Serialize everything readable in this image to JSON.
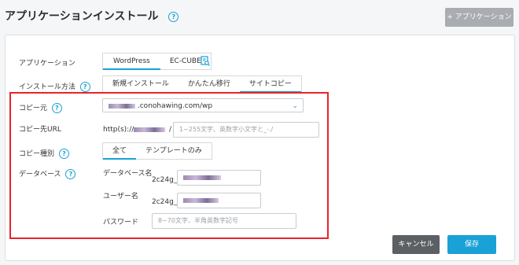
{
  "page": {
    "title": "アプリケーションインストール",
    "help_glyph": "?",
    "top_button_label": "+ アプリケーション"
  },
  "form": {
    "app_label": "アプリケーション",
    "app_tabs": [
      "WordPress",
      "EC-CUBE"
    ],
    "method_label": "インストール方法",
    "method_tabs": [
      "新規インストール",
      "かんたん移行",
      "サイトコピー"
    ],
    "copy_from_label": "コピー元",
    "copy_from_value": ".conohawing.com/wp",
    "copy_to_url_label": "コピー先URL",
    "copy_to_url_prefix": "http(s)://",
    "copy_to_url_slash": "/",
    "copy_to_path_placeholder": "1~255文字、英数字小文字と_-./",
    "copy_type_label": "コピー種別",
    "copy_type_tabs": [
      "全て",
      "テンプレートのみ"
    ],
    "database_label": "データベース",
    "db_name_label": "データベース名",
    "db_prefix": "2c24g_",
    "db_user_label": "ユーザー名",
    "user_prefix": "2c24g_",
    "password_label": "パスワード",
    "password_placeholder": "8~70文字、半角英数字記号"
  },
  "actions": {
    "cancel_label": "キャンセル",
    "save_label": "保存"
  },
  "colors": {
    "accent": "#1aa1d6",
    "highlight_border": "#e8232a",
    "cancel_bg": "#5b6065",
    "save_bg": "#1aa1d6",
    "top_button_bg": "#a9acb0"
  }
}
